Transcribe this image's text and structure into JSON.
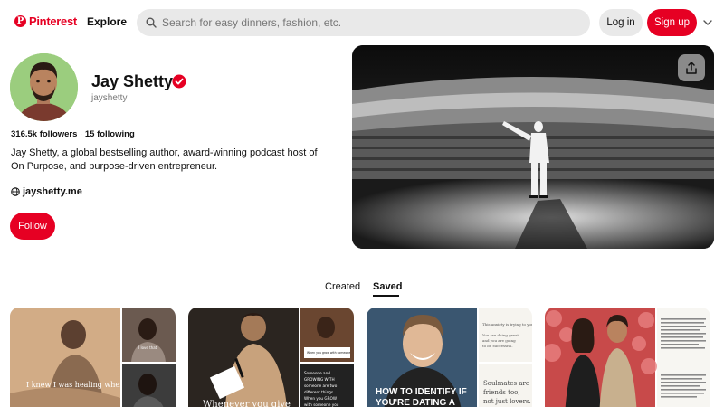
{
  "header": {
    "logo_text": "Pinterest",
    "logo_letter": "P",
    "explore_label": "Explore",
    "search_placeholder": "Search for easy dinners, fashion, etc.",
    "login_label": "Log in",
    "signup_label": "Sign up",
    "brand_color": "#e60023"
  },
  "profile": {
    "name": "Jay Shetty",
    "handle": "jayshetty",
    "followers": "316.5k followers",
    "separator": " · ",
    "following": "15 following",
    "bio": "Jay Shetty, a global bestselling author, award-winning podcast host of On Purpose, and purpose-driven entrepreneur.",
    "website": "jayshetty.me",
    "follow_label": "Follow"
  },
  "tabs": {
    "created": "Created",
    "saved": "Saved"
  },
  "boards": [
    {
      "caption": "I knew I was healing when...",
      "side_text": "I love that"
    },
    {
      "caption": "Whenever you give",
      "side_text_1": "Someone and GROWING WITH someone are two different things. When you GROW with someone you like who you're becoming",
      "side_text_2": "When you grow with someone"
    },
    {
      "caption_line1": "HOW TO IDENTIFY IF",
      "caption_line2": "YOU'RE DATING A",
      "side_text_1": "This anxiety is trying to you.",
      "side_text_2": "You are doing great, and you are going to be successful.",
      "side_text_3": "Soulmates are friends too, not just lovers."
    },
    {
      "side_text_1": "When people talk about soulmates, we think about them as two halves of a whole...",
      "side_text_2": "Some of our soulmates are friends..."
    }
  ]
}
